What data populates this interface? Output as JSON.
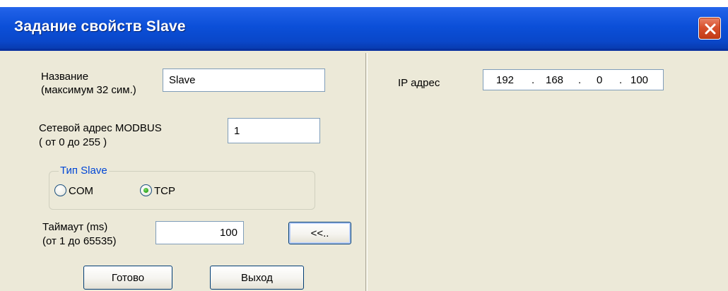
{
  "window": {
    "title": "Задание свойств Slave"
  },
  "form": {
    "name_label_line1": "Название",
    "name_label_line2": "(максимум 32 сим.)",
    "name_value": "Slave",
    "address_label_line1": "Сетевой адрес MODBUS",
    "address_label_line2": "( от 0 до 255 )",
    "address_value": "1",
    "slave_type_group": "Тип Slave",
    "slave_type_options": [
      {
        "label": "COM",
        "selected": false
      },
      {
        "label": "TCP",
        "selected": true
      }
    ],
    "timeout_label_line1": "Таймаут (ms)",
    "timeout_label_line2": "(от 1 до 65535)",
    "timeout_value": "100",
    "collapse_button": "<<..",
    "ok_button": "Готово",
    "exit_button": "Выход"
  },
  "network": {
    "ip_label": "IP адрес",
    "ip_octets": [
      "192",
      "168",
      "0",
      "100"
    ]
  },
  "colors": {
    "titlebar": "#0a4bd6",
    "client_bg": "#ece9d8",
    "group_legend": "#0046d5",
    "close_button": "#d8512e"
  },
  "icons": {
    "close": "close-icon",
    "radio": "radio-icon"
  }
}
